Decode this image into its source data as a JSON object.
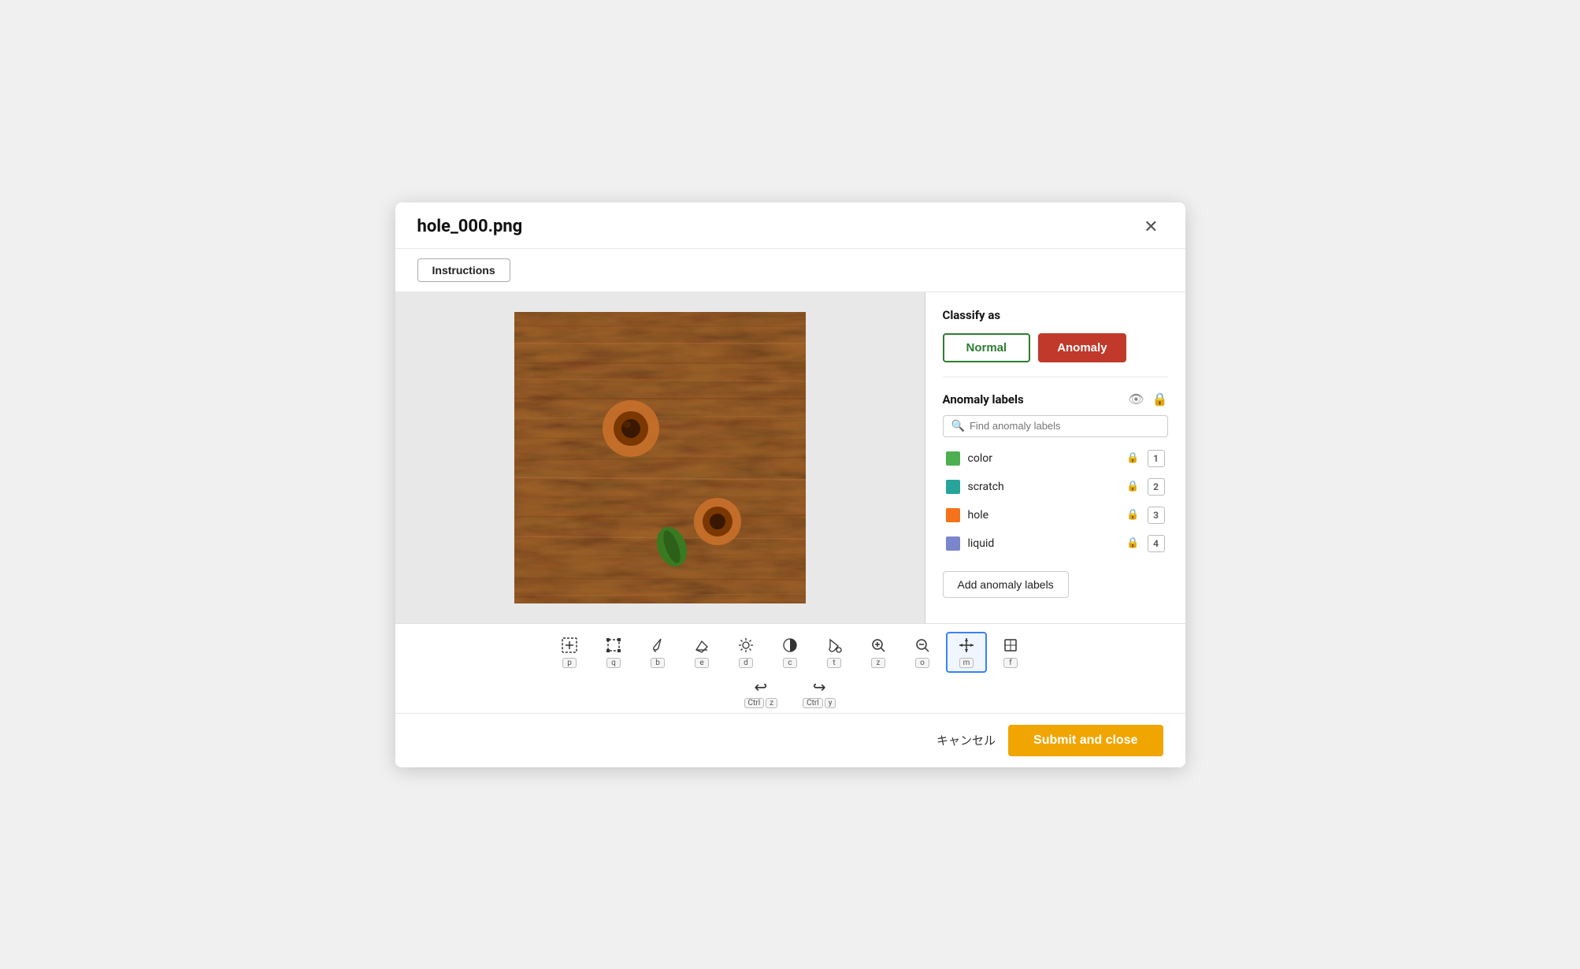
{
  "header": {
    "title": "hole_000.png",
    "close_label": "✕"
  },
  "instructions_btn": "Instructions",
  "classify": {
    "title": "Classify as",
    "normal_label": "Normal",
    "anomaly_label": "Anomaly"
  },
  "anomaly_labels": {
    "title": "Anomaly labels",
    "search_placeholder": "Find anomaly labels",
    "labels": [
      {
        "name": "color",
        "color": "#4caf50",
        "num": "1"
      },
      {
        "name": "scratch",
        "color": "#26a69a",
        "num": "2"
      },
      {
        "name": "hole",
        "color": "#f5721a",
        "num": "3"
      },
      {
        "name": "liquid",
        "color": "#7986cb",
        "num": "4"
      }
    ],
    "add_label_btn": "Add anomaly labels"
  },
  "tools": [
    {
      "icon": "⊞",
      "key": "p",
      "label": "add-bbox-tool"
    },
    {
      "icon": "⊟",
      "key": "q",
      "label": "edit-bbox-tool"
    },
    {
      "icon": "✏",
      "key": "b",
      "label": "brush-tool"
    },
    {
      "icon": "✒",
      "key": "e",
      "label": "eraser-tool"
    },
    {
      "icon": "☀",
      "key": "d",
      "label": "brightness-tool"
    },
    {
      "icon": "◑",
      "key": "c",
      "label": "contrast-tool"
    },
    {
      "icon": "⬡",
      "key": "t",
      "label": "fill-tool"
    },
    {
      "icon": "⊕",
      "key": "z",
      "label": "zoom-in-tool"
    },
    {
      "icon": "⊖",
      "key": "o",
      "label": "zoom-out-tool"
    },
    {
      "icon": "✛",
      "key": "m",
      "label": "move-tool",
      "active": true
    },
    {
      "icon": "⊡",
      "key": "f",
      "label": "fit-tool"
    }
  ],
  "undo": {
    "icon": "↩",
    "keys": [
      "Ctrl",
      "z"
    ]
  },
  "redo": {
    "icon": "↪",
    "keys": [
      "Ctrl",
      "y"
    ]
  },
  "footer": {
    "cancel_label": "キャンセル",
    "submit_label": "Submit and close"
  }
}
